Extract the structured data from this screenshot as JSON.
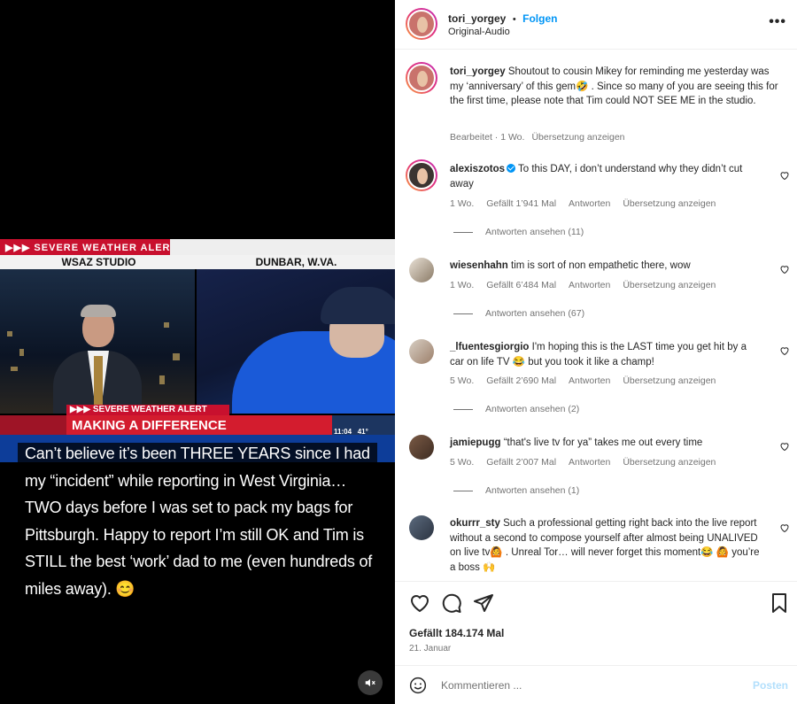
{
  "media": {
    "tv": {
      "alert_top": "▶▶▶ SEVERE WEATHER ALERT",
      "location_left": "WSAZ STUDIO",
      "location_right": "DUNBAR, W.VA.",
      "lower_alert": "▶▶▶ SEVERE WEATHER ALERT",
      "lower_headline": "MAKING A DIFFERENCE",
      "time": "11:04",
      "temperature": "41°"
    },
    "caption": "Can’t believe it’s been THREE YEARS since I had my “incident” while reporting in West Virginia…TWO days before I was set to pack my bags for Pittsburgh. Happy to report I’m still OK and Tim is STILL the best ‘work’ dad to me (even hundreds of miles away). 😊",
    "mute_icon": "speaker-muted-icon"
  },
  "header": {
    "username": "tori_yorgey",
    "separator": "•",
    "follow_label": "Folgen",
    "audio": "Original-Audio",
    "more_icon": "•••"
  },
  "caption_comment": {
    "username": "tori_yorgey",
    "text": "Shoutout to cousin Mikey for reminding me yesterday was my ‘anniversary’ of this gem🤣 . Since so many of you are seeing this for the first time, please note that Tim could NOT SEE ME in the studio.",
    "edited": "Bearbeitet · 1 Wo.",
    "translate": "Übersetzung anzeigen"
  },
  "comments": [
    {
      "username": "alexiszotos",
      "verified": true,
      "text": "To this DAY, i don’t understand why they didn’t cut away",
      "age": "1 Wo.",
      "likes": "Gefällt 1’941 Mal",
      "reply": "Antworten",
      "translate": "Übersetzung anzeigen",
      "view_replies": "Antworten ansehen (11)"
    },
    {
      "username": "wiesenhahn",
      "verified": false,
      "text": "tim is sort of non empathetic there, wow",
      "age": "1 Wo.",
      "likes": "Gefällt 6’484 Mal",
      "reply": "Antworten",
      "translate": "Übersetzung anzeigen",
      "view_replies": "Antworten ansehen (67)"
    },
    {
      "username": "_lfuentesgiorgio",
      "verified": false,
      "text": "I'm hoping this is the LAST time you get hit by a car on life TV 😂 but you took it like a champ!",
      "age": "5 Wo.",
      "likes": "Gefällt 2’690 Mal",
      "reply": "Antworten",
      "translate": "Übersetzung anzeigen",
      "view_replies": "Antworten ansehen (2)"
    },
    {
      "username": "jamiepugg",
      "verified": false,
      "text": "“that's live tv for ya” takes me out every time",
      "age": "5 Wo.",
      "likes": "Gefällt 2’007 Mal",
      "reply": "Antworten",
      "translate": "Übersetzung anzeigen",
      "view_replies": "Antworten ansehen (1)"
    },
    {
      "username": "okurrr_sty",
      "verified": false,
      "text": "Such a professional getting right back into the live report without a second to compose yourself after almost being UNALIVED on live tv🙆 . Unreal Tor… will never forget this moment😂 🙆  you’re a boss 🙌",
      "age": "",
      "likes": "",
      "reply": "",
      "translate": "",
      "view_replies": ""
    }
  ],
  "actions": {
    "likes": "Gefällt 184.174 Mal",
    "date": "21. Januar"
  },
  "composer": {
    "placeholder": "Kommentieren ...",
    "post_label": "Posten"
  },
  "colors": {
    "accent": "#0095f6",
    "alert_red": "#c8102e",
    "muted_text": "#737373"
  }
}
